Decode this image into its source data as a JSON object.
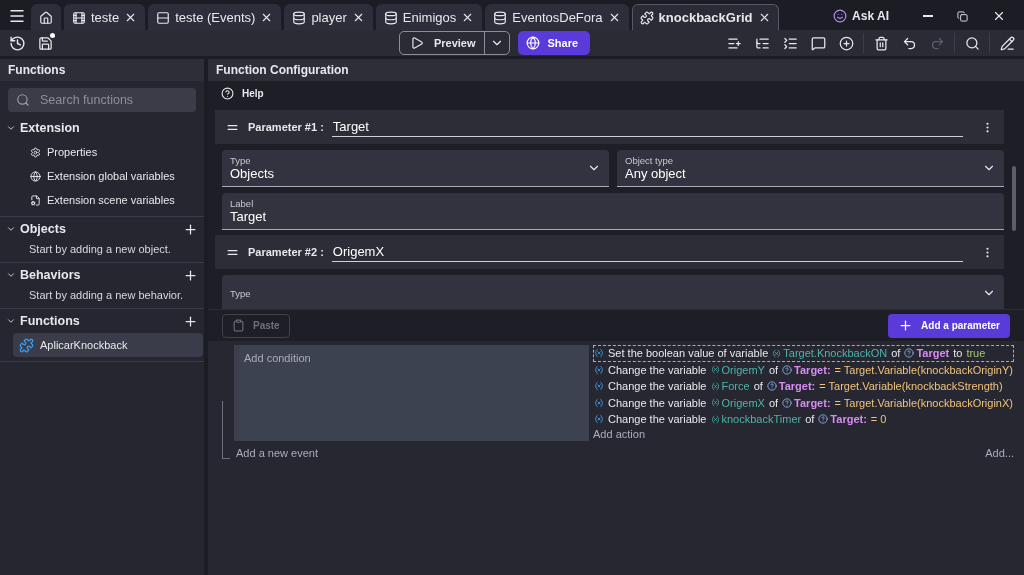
{
  "tabs": [
    {
      "kind": "home",
      "selected": false
    },
    {
      "kind": "scene",
      "label": "teste",
      "selected": false
    },
    {
      "kind": "events",
      "label": "teste (Events)",
      "selected": false
    },
    {
      "kind": "object",
      "label": "player",
      "selected": false
    },
    {
      "kind": "object",
      "label": "Enimigos",
      "selected": false
    },
    {
      "kind": "object",
      "label": "EventosDeFora",
      "selected": false
    },
    {
      "kind": "extension",
      "label": "knockbackGrid",
      "selected": true
    }
  ],
  "ask_ai": "Ask AI",
  "toolbar": {
    "unsaved": true,
    "preview": "Preview",
    "share": "Share",
    "icons": [
      {
        "kind": "addevent",
        "disabled": false
      },
      {
        "kind": "addsubevent",
        "disabled": false
      },
      {
        "kind": "addother",
        "disabled": false
      },
      {
        "kind": "comment",
        "disabled": false
      },
      {
        "kind": "add",
        "disabled": false
      },
      {
        "kind": "delete",
        "disabled": false
      },
      {
        "kind": "undo",
        "disabled": false
      },
      {
        "kind": "redo",
        "disabled": true
      },
      {
        "kind": "search",
        "disabled": false
      },
      {
        "kind": "edit",
        "disabled": false
      }
    ]
  },
  "sidebar": {
    "title": "Functions",
    "search": {
      "placeholder": "Search functions"
    },
    "sections": [
      {
        "title": "Extension",
        "expanded": true,
        "addable": false,
        "items": [
          {
            "kind": "properties",
            "label": "Properties",
            "selected": false
          },
          {
            "kind": "globalvars",
            "label": "Extension global variables",
            "selected": false
          },
          {
            "kind": "scenevars",
            "label": "Extension scene variables",
            "selected": false
          }
        ]
      },
      {
        "title": "Objects",
        "expanded": true,
        "addable": true,
        "hint": "Start by adding a new object."
      },
      {
        "title": "Behaviors",
        "expanded": true,
        "addable": true,
        "hint": "Start by adding a new behavior."
      },
      {
        "title": "Functions",
        "expanded": true,
        "addable": true,
        "items": [
          {
            "kind": "function",
            "label": "AplicarKnockback",
            "selected": true
          }
        ]
      }
    ]
  },
  "config": {
    "title": "Function Configuration",
    "help": "Help",
    "parameters": [
      {
        "label": "Parameter #1 :",
        "name": "Target",
        "fields": [
          {
            "label": "Type",
            "value": "Objects",
            "dropdown": true
          },
          {
            "label": "Object type",
            "value": "Any object",
            "dropdown": true
          },
          {
            "label": "Label",
            "value": "Target",
            "dropdown": false
          }
        ]
      },
      {
        "label": "Parameter #2 :",
        "name": "OrigemX",
        "fields": [
          {
            "label": "Type",
            "dropdown": true
          }
        ]
      }
    ],
    "paste": "Paste",
    "add_parameter": "Add a parameter"
  },
  "events": {
    "condition_placeholder": "Add condition",
    "add_action": "Add action",
    "add_event": "Add a new event",
    "add_more": "Add...",
    "actions": [
      {
        "selected": true,
        "parts": [
          {
            "kind": "text",
            "text": "Set the boolean value of variable"
          },
          {
            "kind": "variable",
            "text": "Target.KnockbackON"
          },
          {
            "kind": "text",
            "text": "of"
          },
          {
            "kind": "object",
            "text": "Target"
          },
          {
            "kind": "text",
            "text": "to"
          },
          {
            "kind": "boolean",
            "text": "true"
          }
        ]
      },
      {
        "selected": false,
        "parts": [
          {
            "kind": "text",
            "text": "Change the variable"
          },
          {
            "kind": "variable",
            "text": "OrigemY"
          },
          {
            "kind": "text",
            "text": "of"
          },
          {
            "kind": "object",
            "text": "Target:"
          },
          {
            "kind": "value",
            "text": "= Target.Variable(knockbackOriginY)"
          }
        ]
      },
      {
        "selected": false,
        "parts": [
          {
            "kind": "text",
            "text": "Change the variable"
          },
          {
            "kind": "variable",
            "text": "Force"
          },
          {
            "kind": "text",
            "text": "of"
          },
          {
            "kind": "object",
            "text": "Target:"
          },
          {
            "kind": "value",
            "text": "= Target.Variable(knockbackStrength)"
          }
        ]
      },
      {
        "selected": false,
        "parts": [
          {
            "kind": "text",
            "text": "Change the variable"
          },
          {
            "kind": "variable",
            "text": "OrigemX"
          },
          {
            "kind": "text",
            "text": "of"
          },
          {
            "kind": "object",
            "text": "Target:"
          },
          {
            "kind": "value",
            "text": "= Target.Variable(knockbackOriginX)"
          }
        ]
      },
      {
        "selected": false,
        "parts": [
          {
            "kind": "text",
            "text": "Change the variable"
          },
          {
            "kind": "variable",
            "text": "knockbackTimer"
          },
          {
            "kind": "text",
            "text": "of"
          },
          {
            "kind": "object",
            "text": "Target:"
          },
          {
            "kind": "value",
            "text": "= 0"
          }
        ]
      }
    ]
  }
}
